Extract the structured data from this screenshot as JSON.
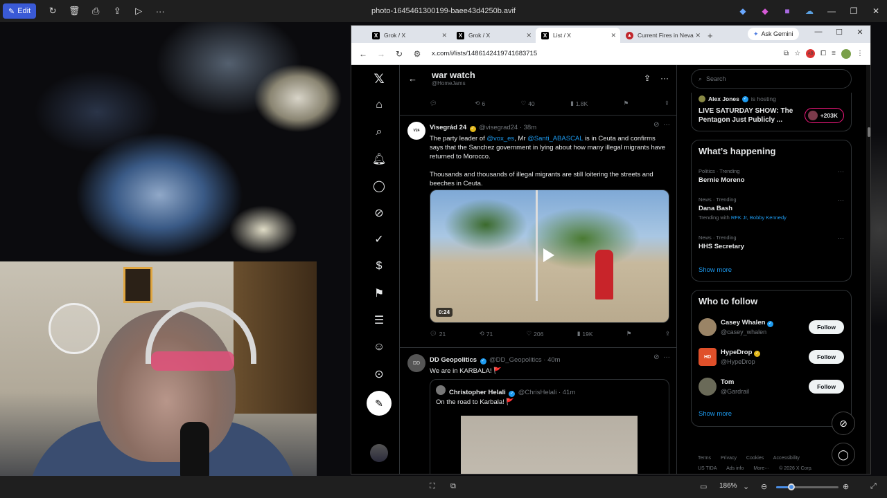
{
  "viewer": {
    "edit_label": "Edit",
    "file_title": "photo-1645461300199-baee43d4250b.avif",
    "zoom": "186%",
    "zoom_fraction": 0.2
  },
  "browser": {
    "tabs": [
      {
        "label": "Grok / X",
        "icon": "x-logo"
      },
      {
        "label": "Grok / X",
        "icon": "x-logo"
      },
      {
        "label": "List / X",
        "icon": "x-logo",
        "active": true
      },
      {
        "label": "Current Fires in Neva",
        "icon": "fire-logo"
      }
    ],
    "ask_gemini": "Ask Gemini",
    "url": "x.com/i/lists/1486142419741683715"
  },
  "list": {
    "title": "war watch",
    "handle": "@HomeJams"
  },
  "first_actions": {
    "replies": "",
    "reposts": "6",
    "likes": "40",
    "views": "1.8K"
  },
  "tweets": [
    {
      "name": "Visegrád 24",
      "handle": "@visegrad24 · 38m",
      "text_1": "The party leader of ",
      "mention_1": "@vox_es",
      "text_2": ", Mr ",
      "mention_2": "@Santi_ABASCAL",
      "text_3": " is in Ceuta and confirms says that the Sanchez government in lying about how many illegal migrants have returned to Morocco.\n\nThousands and thousands of illegal migrants are still loitering the streets and beeches in Ceuta.",
      "video_duration": "0:24",
      "replies": "21",
      "reposts": "71",
      "likes": "206",
      "views": "19K"
    },
    {
      "name": "DD Geopolitics",
      "handle": "@DD_Geopolitics · 40m",
      "text": "We are in KARBALA! 🚩",
      "quote_name": "Christopher Helali",
      "quote_handle": "@ChrisHelali · 41m",
      "quote_text": "On the road to Karbala! 🚩"
    }
  ],
  "sidebar": {
    "search_placeholder": "Search",
    "space_host": "Alex Jones",
    "space_hosting": "is hosting",
    "space_title": "LIVE SATURDAY SHOW: The Pentagon Just Publicly ...",
    "space_count": "+203K",
    "whats_happening": "What’s happening",
    "trends": [
      {
        "meta": "Politics · Trending",
        "name": "Bernie Moreno",
        "with": ""
      },
      {
        "meta": "News · Trending",
        "name": "Dana Bash",
        "with_label": "Trending with",
        "with": "RFK Jr, Bobby Kennedy"
      },
      {
        "meta": "News · Trending",
        "name": "HHS Secretary",
        "with": ""
      }
    ],
    "show_more": "Show more",
    "who_to_follow": "Who to follow",
    "follow": [
      {
        "name": "Casey Whalen",
        "handle": "@casey_whalen",
        "button": "Follow"
      },
      {
        "name": "HypeDrop",
        "handle": "@HypeDrop",
        "button": "Follow"
      },
      {
        "name": "Tom",
        "handle": "@Gardrail",
        "button": "Follow"
      }
    ],
    "show_more_2": "Show more",
    "footer": [
      "Terms",
      "Privacy",
      "Cookies",
      "Accessibility",
      "US TIDA",
      "Ads info",
      "More···",
      "© 2026 X Corp."
    ]
  }
}
